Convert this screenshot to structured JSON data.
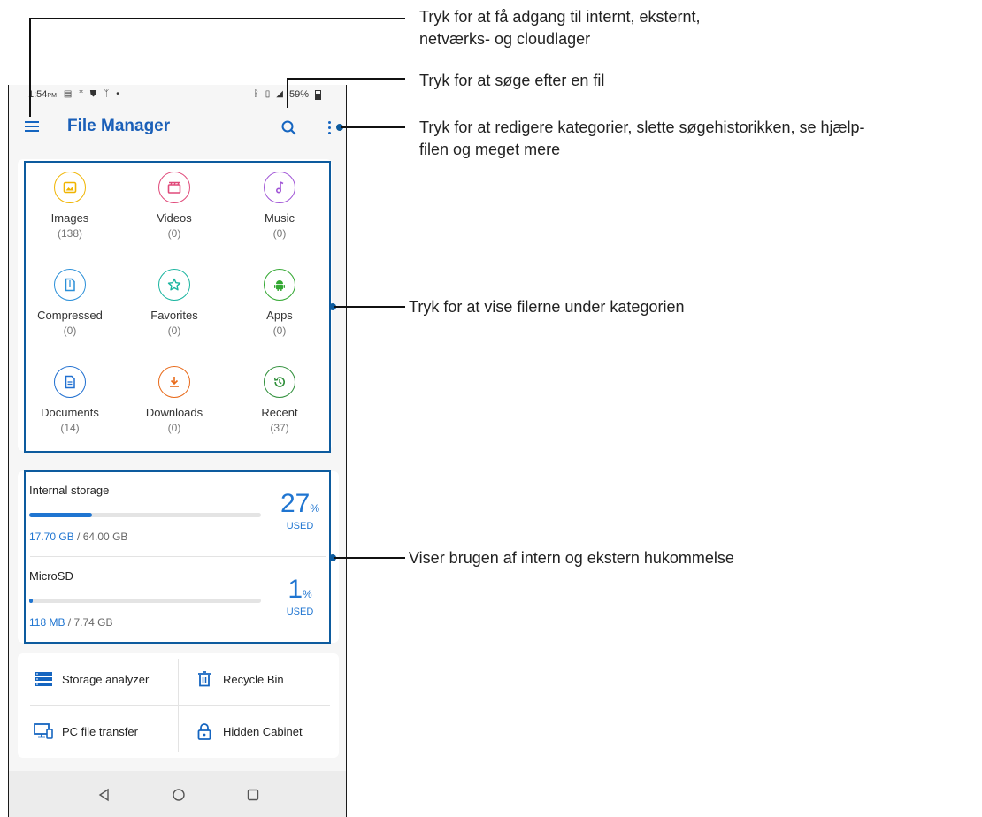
{
  "status_bar": {
    "time": "1:54",
    "ampm": "PM",
    "battery": "59%",
    "left_icons": [
      "calendar-icon",
      "upload-icon",
      "shield-icon",
      "signal-off-icon",
      "dot-icon"
    ],
    "right_icons": [
      "bluetooth-icon",
      "vibrate-icon",
      "cell-signal-icon",
      "battery-icon"
    ]
  },
  "app_bar": {
    "title": "File Manager",
    "icons": [
      "menu-icon",
      "search-icon",
      "more-vert-icon"
    ]
  },
  "categories": [
    {
      "label": "Images",
      "count": "(138)",
      "icon": "image-icon",
      "color": "#f0b400"
    },
    {
      "label": "Videos",
      "count": "(0)",
      "icon": "clapper-icon",
      "color": "#e04a7a"
    },
    {
      "label": "Music",
      "count": "(0)",
      "icon": "music-note-icon",
      "color": "#a054d6"
    },
    {
      "label": "Compressed",
      "count": "(0)",
      "icon": "zip-file-icon",
      "color": "#2a8fd8"
    },
    {
      "label": "Favorites",
      "count": "(0)",
      "icon": "star-icon",
      "color": "#1bb5a0"
    },
    {
      "label": "Apps",
      "count": "(0)",
      "icon": "android-icon",
      "color": "#33a832"
    },
    {
      "label": "Documents",
      "count": "(14)",
      "icon": "document-icon",
      "color": "#1f6fd0"
    },
    {
      "label": "Downloads",
      "count": "(0)",
      "icon": "download-icon",
      "color": "#e86a1a"
    },
    {
      "label": "Recent",
      "count": "(37)",
      "icon": "history-icon",
      "color": "#2f8f3a"
    }
  ],
  "storage": [
    {
      "name": "Internal storage",
      "used": "17.70 GB",
      "total": " / 64.00 GB",
      "percent": "27",
      "percent_symbol": "%",
      "used_label": "USED",
      "fraction": 0.27
    },
    {
      "name": "MicroSD",
      "used": "118 MB",
      "total": " / 7.74 GB",
      "percent": "1",
      "percent_symbol": "%",
      "used_label": "USED",
      "fraction": 0.015
    }
  ],
  "tools": [
    {
      "label": "Storage analyzer",
      "icon": "storage-list-icon"
    },
    {
      "label": "Recycle Bin",
      "icon": "trash-icon"
    },
    {
      "label": "PC file transfer",
      "icon": "pc-transfer-icon"
    },
    {
      "label": "Hidden Cabinet",
      "icon": "lock-icon"
    }
  ],
  "nav_bar": {
    "icons": [
      "back-icon",
      "home-icon",
      "recents-icon"
    ]
  },
  "callouts": {
    "menu": [
      "Tryk for at få adgang til internt, eksternt,",
      "netværks- og cloudlager"
    ],
    "search": [
      "Tryk for at søge efter en fil"
    ],
    "more": [
      "Tryk for at redigere kategorier, slette søgehistorikken, se hjælp-",
      "filen og meget mere"
    ],
    "categories": [
      "Tryk for at vise filerne under kategorien"
    ],
    "storage": [
      "Viser brugen af intern og ekstern hukommelse"
    ]
  },
  "colors": {
    "accent": "#1565c0",
    "callout_box": "#0d5b9e"
  }
}
